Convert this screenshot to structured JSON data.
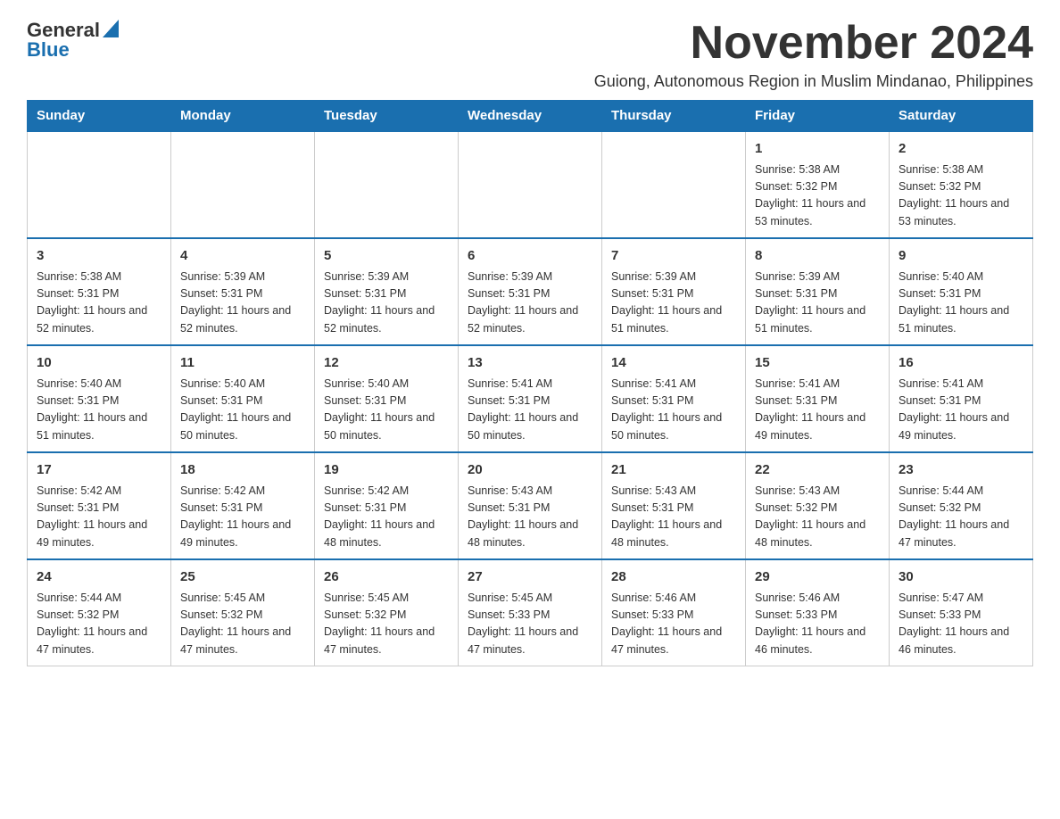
{
  "logo": {
    "general": "General",
    "blue": "Blue"
  },
  "title": "November 2024",
  "subtitle": "Guiong, Autonomous Region in Muslim Mindanao, Philippines",
  "days_of_week": [
    "Sunday",
    "Monday",
    "Tuesday",
    "Wednesday",
    "Thursday",
    "Friday",
    "Saturday"
  ],
  "weeks": [
    [
      {
        "day": "",
        "info": ""
      },
      {
        "day": "",
        "info": ""
      },
      {
        "day": "",
        "info": ""
      },
      {
        "day": "",
        "info": ""
      },
      {
        "day": "",
        "info": ""
      },
      {
        "day": "1",
        "info": "Sunrise: 5:38 AM\nSunset: 5:32 PM\nDaylight: 11 hours and 53 minutes."
      },
      {
        "day": "2",
        "info": "Sunrise: 5:38 AM\nSunset: 5:32 PM\nDaylight: 11 hours and 53 minutes."
      }
    ],
    [
      {
        "day": "3",
        "info": "Sunrise: 5:38 AM\nSunset: 5:31 PM\nDaylight: 11 hours and 52 minutes."
      },
      {
        "day": "4",
        "info": "Sunrise: 5:39 AM\nSunset: 5:31 PM\nDaylight: 11 hours and 52 minutes."
      },
      {
        "day": "5",
        "info": "Sunrise: 5:39 AM\nSunset: 5:31 PM\nDaylight: 11 hours and 52 minutes."
      },
      {
        "day": "6",
        "info": "Sunrise: 5:39 AM\nSunset: 5:31 PM\nDaylight: 11 hours and 52 minutes."
      },
      {
        "day": "7",
        "info": "Sunrise: 5:39 AM\nSunset: 5:31 PM\nDaylight: 11 hours and 51 minutes."
      },
      {
        "day": "8",
        "info": "Sunrise: 5:39 AM\nSunset: 5:31 PM\nDaylight: 11 hours and 51 minutes."
      },
      {
        "day": "9",
        "info": "Sunrise: 5:40 AM\nSunset: 5:31 PM\nDaylight: 11 hours and 51 minutes."
      }
    ],
    [
      {
        "day": "10",
        "info": "Sunrise: 5:40 AM\nSunset: 5:31 PM\nDaylight: 11 hours and 51 minutes."
      },
      {
        "day": "11",
        "info": "Sunrise: 5:40 AM\nSunset: 5:31 PM\nDaylight: 11 hours and 50 minutes."
      },
      {
        "day": "12",
        "info": "Sunrise: 5:40 AM\nSunset: 5:31 PM\nDaylight: 11 hours and 50 minutes."
      },
      {
        "day": "13",
        "info": "Sunrise: 5:41 AM\nSunset: 5:31 PM\nDaylight: 11 hours and 50 minutes."
      },
      {
        "day": "14",
        "info": "Sunrise: 5:41 AM\nSunset: 5:31 PM\nDaylight: 11 hours and 50 minutes."
      },
      {
        "day": "15",
        "info": "Sunrise: 5:41 AM\nSunset: 5:31 PM\nDaylight: 11 hours and 49 minutes."
      },
      {
        "day": "16",
        "info": "Sunrise: 5:41 AM\nSunset: 5:31 PM\nDaylight: 11 hours and 49 minutes."
      }
    ],
    [
      {
        "day": "17",
        "info": "Sunrise: 5:42 AM\nSunset: 5:31 PM\nDaylight: 11 hours and 49 minutes."
      },
      {
        "day": "18",
        "info": "Sunrise: 5:42 AM\nSunset: 5:31 PM\nDaylight: 11 hours and 49 minutes."
      },
      {
        "day": "19",
        "info": "Sunrise: 5:42 AM\nSunset: 5:31 PM\nDaylight: 11 hours and 48 minutes."
      },
      {
        "day": "20",
        "info": "Sunrise: 5:43 AM\nSunset: 5:31 PM\nDaylight: 11 hours and 48 minutes."
      },
      {
        "day": "21",
        "info": "Sunrise: 5:43 AM\nSunset: 5:31 PM\nDaylight: 11 hours and 48 minutes."
      },
      {
        "day": "22",
        "info": "Sunrise: 5:43 AM\nSunset: 5:32 PM\nDaylight: 11 hours and 48 minutes."
      },
      {
        "day": "23",
        "info": "Sunrise: 5:44 AM\nSunset: 5:32 PM\nDaylight: 11 hours and 47 minutes."
      }
    ],
    [
      {
        "day": "24",
        "info": "Sunrise: 5:44 AM\nSunset: 5:32 PM\nDaylight: 11 hours and 47 minutes."
      },
      {
        "day": "25",
        "info": "Sunrise: 5:45 AM\nSunset: 5:32 PM\nDaylight: 11 hours and 47 minutes."
      },
      {
        "day": "26",
        "info": "Sunrise: 5:45 AM\nSunset: 5:32 PM\nDaylight: 11 hours and 47 minutes."
      },
      {
        "day": "27",
        "info": "Sunrise: 5:45 AM\nSunset: 5:33 PM\nDaylight: 11 hours and 47 minutes."
      },
      {
        "day": "28",
        "info": "Sunrise: 5:46 AM\nSunset: 5:33 PM\nDaylight: 11 hours and 47 minutes."
      },
      {
        "day": "29",
        "info": "Sunrise: 5:46 AM\nSunset: 5:33 PM\nDaylight: 11 hours and 46 minutes."
      },
      {
        "day": "30",
        "info": "Sunrise: 5:47 AM\nSunset: 5:33 PM\nDaylight: 11 hours and 46 minutes."
      }
    ]
  ]
}
